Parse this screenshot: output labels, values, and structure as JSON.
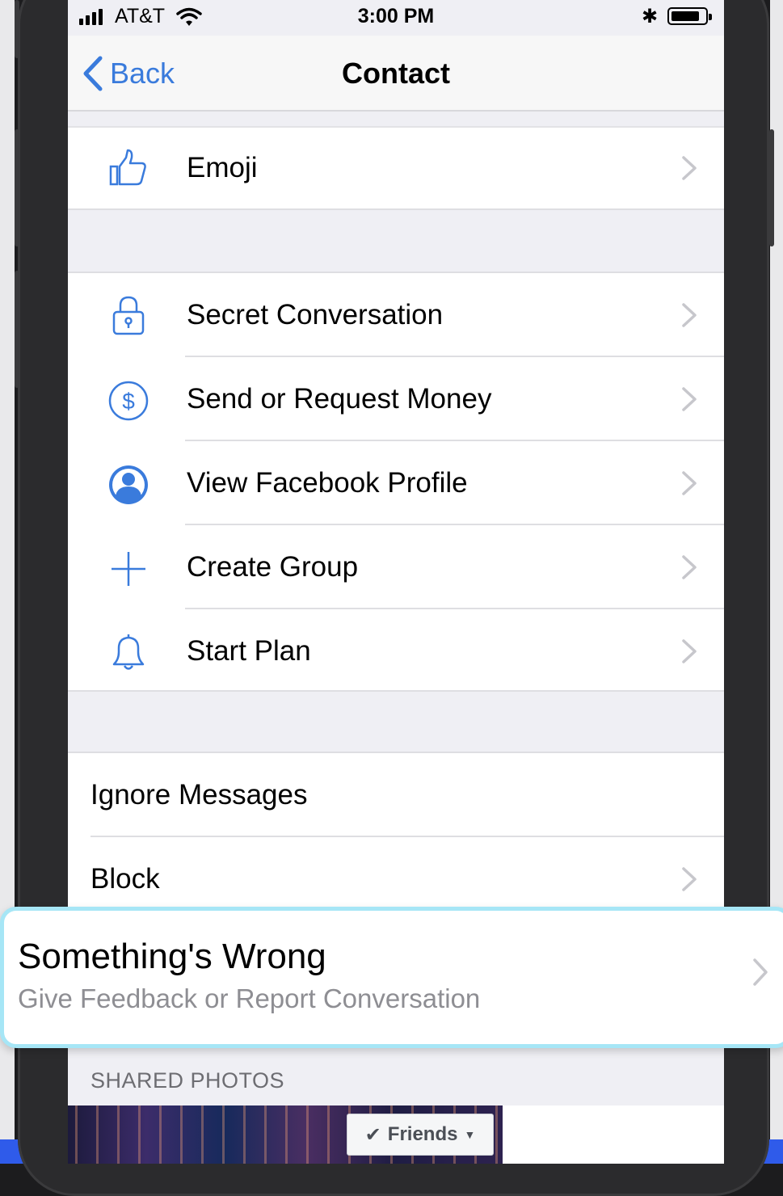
{
  "status_bar": {
    "carrier": "AT&T",
    "time": "3:00 PM",
    "bluetooth_icon": "✱"
  },
  "nav": {
    "back_label": "Back",
    "title": "Contact"
  },
  "group1": [
    {
      "label": "Emoji",
      "icon": "thumbs-up-icon"
    }
  ],
  "group2": [
    {
      "label": "Secret Conversation",
      "icon": "lock-icon"
    },
    {
      "label": "Send or Request Money",
      "icon": "dollar-icon"
    },
    {
      "label": "View Facebook Profile",
      "icon": "profile-icon"
    },
    {
      "label": "Create Group",
      "icon": "plus-icon"
    },
    {
      "label": "Start Plan",
      "icon": "bell-icon"
    }
  ],
  "group3": [
    {
      "label": "Ignore Messages"
    },
    {
      "label": "Block"
    }
  ],
  "highlight": {
    "title": "Something's Wrong",
    "subtitle": "Give Feedback or Report Conversation"
  },
  "shared_photos": {
    "header": "SHARED PHOTOS",
    "friends_button": "Friends"
  },
  "colors": {
    "accent": "#3a7bdc",
    "highlight_border": "#a6e6f6"
  }
}
